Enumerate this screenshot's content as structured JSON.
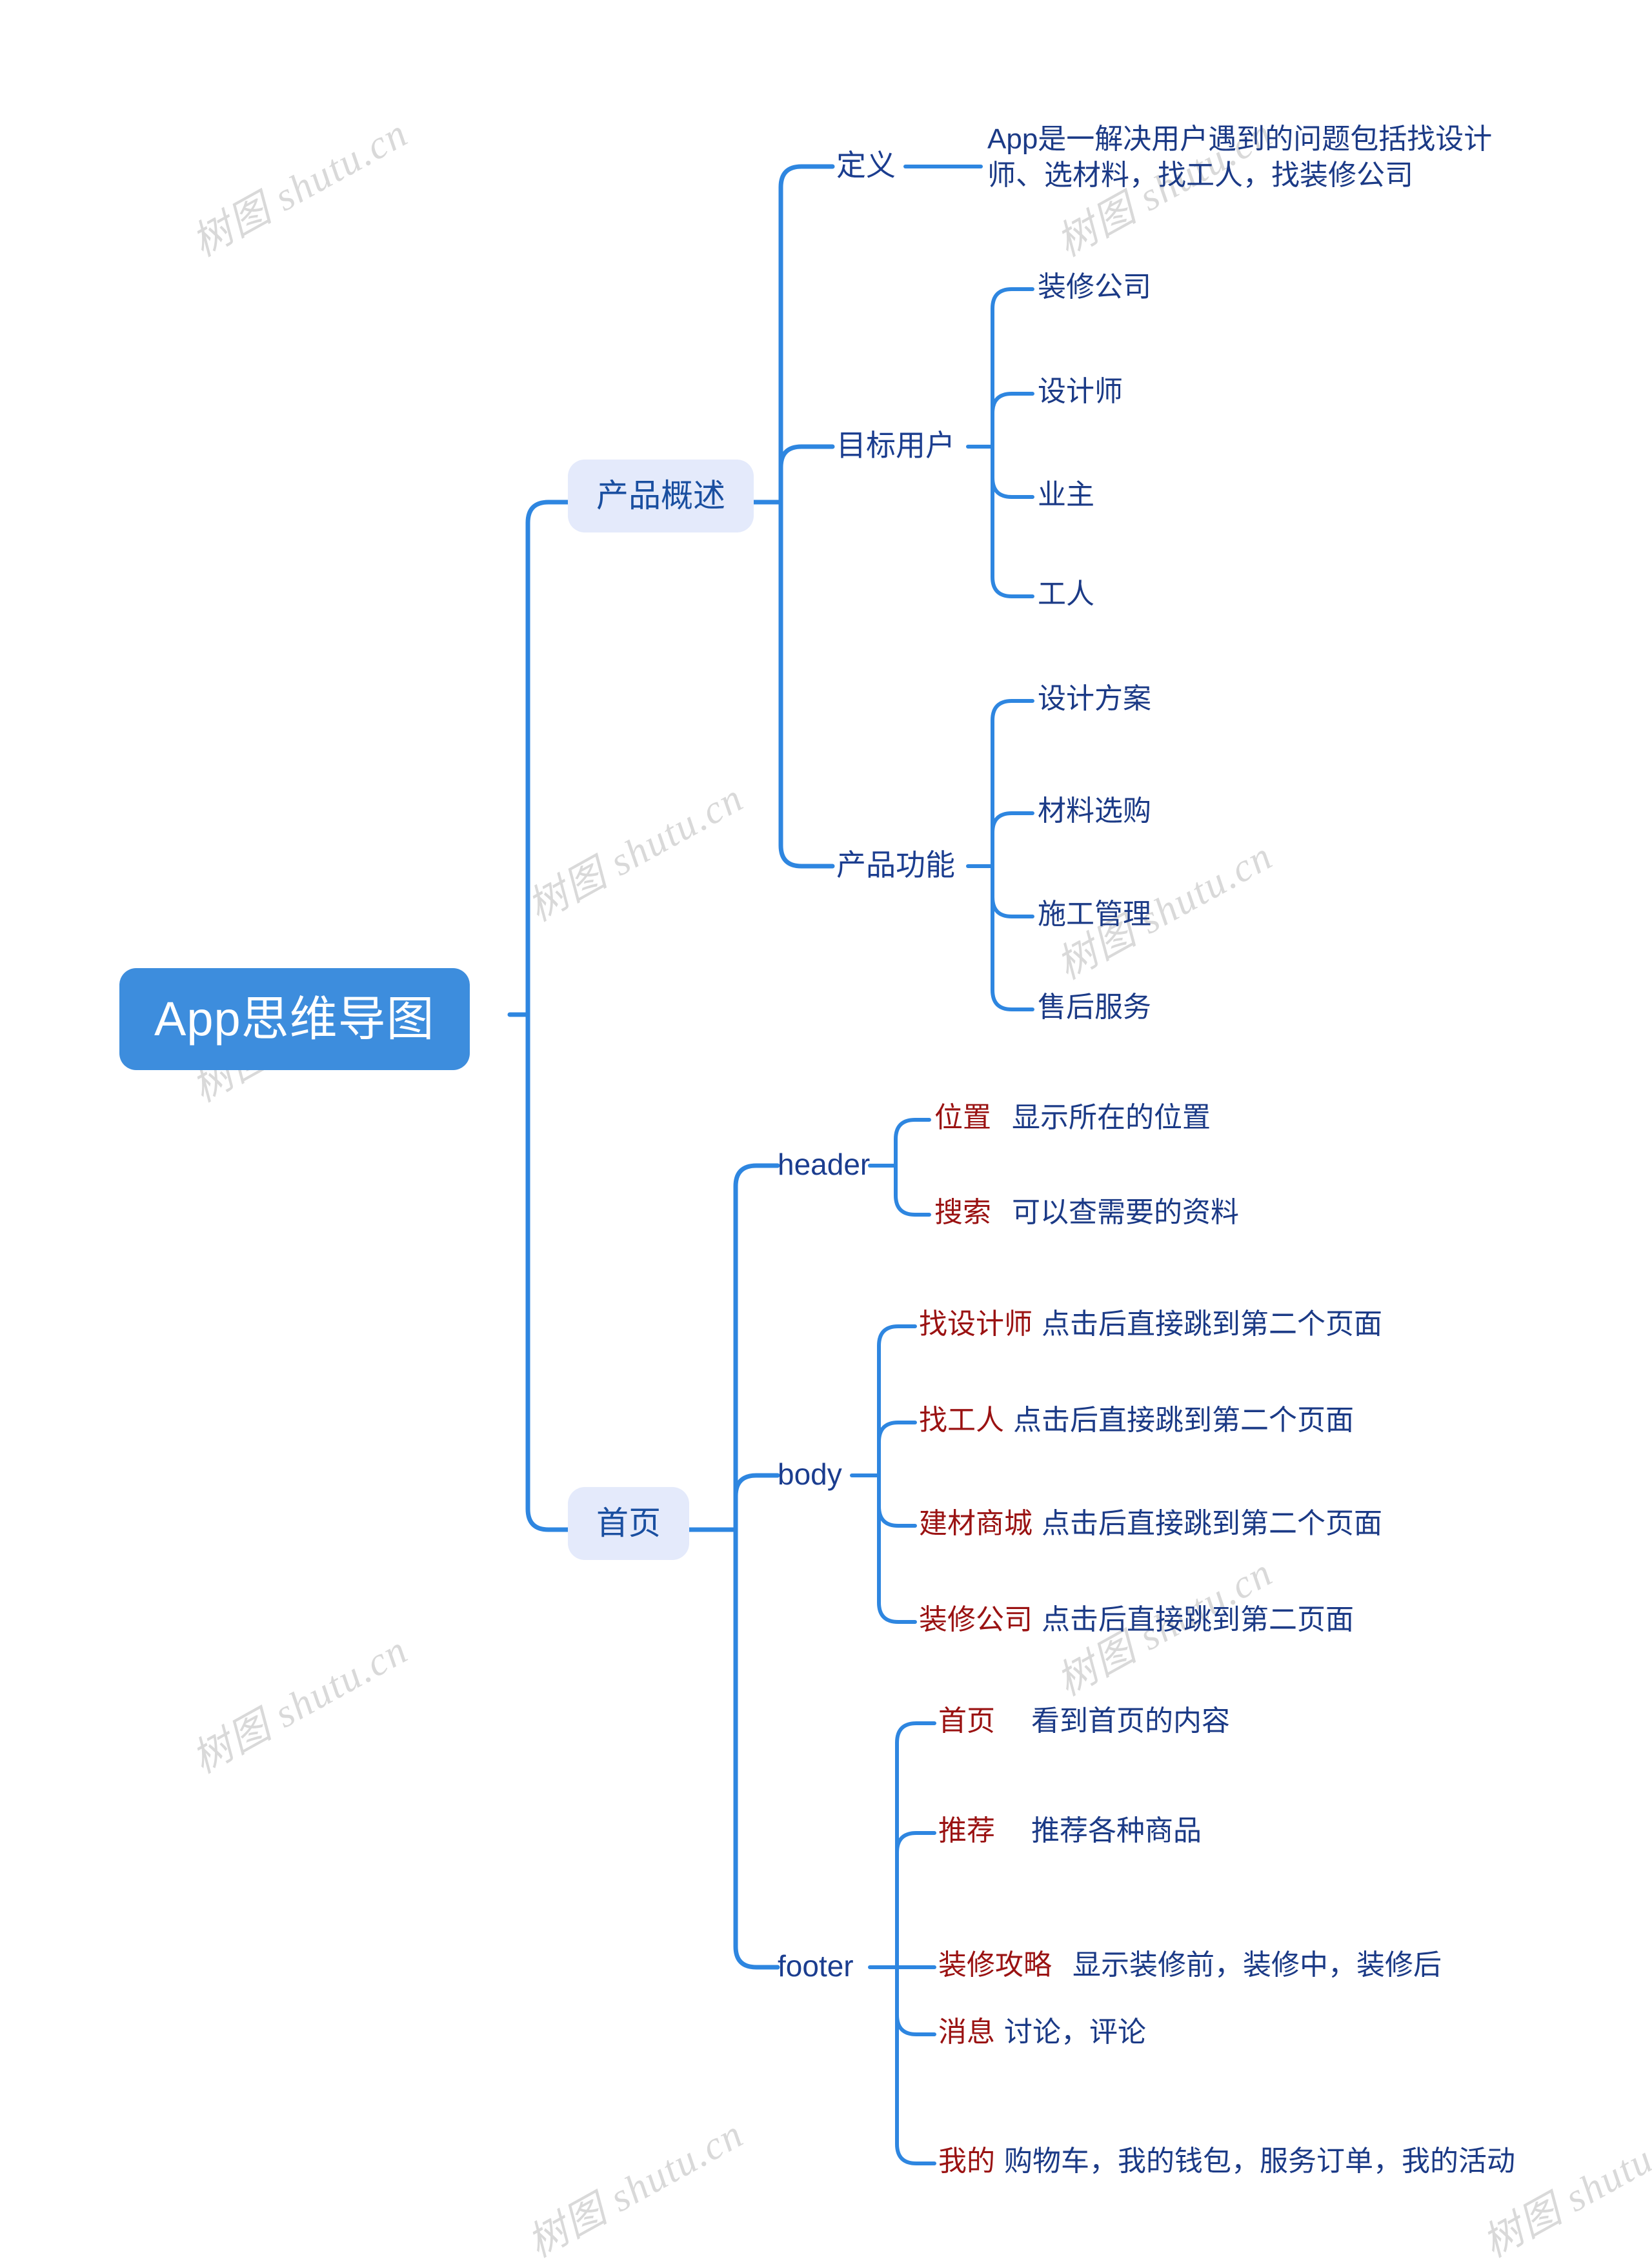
{
  "diagram": {
    "title": "App思维导图",
    "watermark_text": "树图 shutu.cn",
    "colors": {
      "root_fill": "#3d8ddd",
      "root_text": "#ffffff",
      "branch_fill": "#e4eafb",
      "branch_text": "#1a4fa0",
      "link": "#2e86e0",
      "leaf_text": "#1b3a86",
      "keyword_text": "#9a1212",
      "watermark": "#d9d9d9",
      "background": "#ffffff"
    }
  },
  "root": {
    "label": "App思维导图"
  },
  "branches": [
    {
      "label": "产品概述",
      "children": [
        {
          "label": "定义",
          "children": [
            {
              "label": "App是一解决用户遇到的问题包括找设计师、选材料，找工人，找装修公司"
            }
          ]
        },
        {
          "label": "目标用户",
          "children": [
            {
              "label": "装修公司"
            },
            {
              "label": "设计师"
            },
            {
              "label": "业主"
            },
            {
              "label": "工人"
            }
          ]
        },
        {
          "label": "产品功能",
          "children": [
            {
              "label": "设计方案"
            },
            {
              "label": "材料选购"
            },
            {
              "label": "施工管理"
            },
            {
              "label": "售后服务"
            }
          ]
        }
      ]
    },
    {
      "label": "首页",
      "children": [
        {
          "label": "header",
          "children": [
            {
              "keyword": "位置",
              "desc": "显示所在的位置"
            },
            {
              "keyword": "搜索",
              "desc": "可以查需要的资料"
            }
          ]
        },
        {
          "label": "body",
          "children": [
            {
              "keyword": "找设计师",
              "desc": "点击后直接跳到第二个页面"
            },
            {
              "keyword": "找工人",
              "desc": "点击后直接跳到第二个页面"
            },
            {
              "keyword": "建材商城",
              "desc": "点击后直接跳到第二个页面"
            },
            {
              "keyword": "装修公司",
              "desc": "点击后直接跳到第二页面"
            }
          ]
        },
        {
          "label": "footer",
          "children": [
            {
              "keyword": "首页",
              "desc": "看到首页的内容"
            },
            {
              "keyword": "推荐",
              "desc": "推荐各种商品"
            },
            {
              "keyword": "装修攻略",
              "desc": "显示装修前，装修中，装修后"
            },
            {
              "keyword": "消息",
              "desc": "讨论，评论"
            },
            {
              "keyword": "我的",
              "desc": "购物车，我的钱包，服务订单，我的活动"
            }
          ]
        }
      ]
    }
  ]
}
